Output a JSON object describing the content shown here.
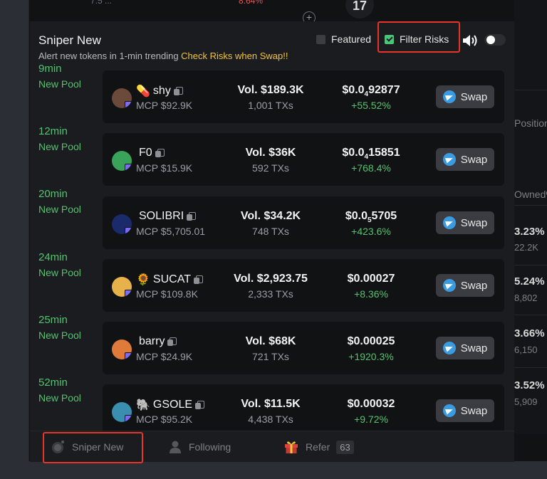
{
  "background": {
    "top_left": "7.5 ...",
    "top_mid": "8.64%",
    "plus": "+",
    "logo": "17",
    "right_col": {
      "header1": "Position",
      "header2": "Owned%",
      "values": [
        {
          "pct": "3.23%",
          "sub": "22.2K"
        },
        {
          "pct": "5.24%",
          "sub": "8,802"
        },
        {
          "pct": "3.66%",
          "sub": "6,150"
        },
        {
          "pct": "3.52%",
          "sub": "5,909"
        }
      ]
    }
  },
  "panel": {
    "title": "Sniper New",
    "subtitle": "Alert new tokens in 1-min trending",
    "subtitle_warning": "Check Risks when Swap!!",
    "featured_label": "Featured",
    "featured_checked": false,
    "filter_risks_label": "Filter Risks",
    "filter_risks_checked": true,
    "sound_icon": "speaker-icon",
    "sound_toggle_on": false
  },
  "rows": [
    {
      "age": "9min",
      "pool": "New Pool",
      "name": "shy",
      "emoji": "💊",
      "mcp": "MCP $92.9K",
      "vol": "Vol. $189.3K",
      "txs": "1,001 TXs",
      "price_a": "$0.0",
      "price_sub": "4",
      "price_b": "92877",
      "pct": "+55.52%",
      "swap": "Swap",
      "avatar_color": "#6b4a3a"
    },
    {
      "age": "12min",
      "pool": "New Pool",
      "name": "F0",
      "emoji": "",
      "mcp": "MCP $15.9K",
      "vol": "Vol. $36K",
      "txs": "592 TXs",
      "price_a": "$0.0",
      "price_sub": "4",
      "price_b": "15851",
      "pct": "+768.4%",
      "swap": "Swap",
      "avatar_color": "#3aa35a"
    },
    {
      "age": "20min",
      "pool": "New Pool",
      "name": "SOLIBRI",
      "emoji": "",
      "mcp": "MCP $5,705.01",
      "vol": "Vol. $34.2K",
      "txs": "748 TXs",
      "price_a": "$0.0",
      "price_sub": "5",
      "price_b": "5705",
      "pct": "+423.6%",
      "swap": "Swap",
      "avatar_color": "#1a2a6b"
    },
    {
      "age": "24min",
      "pool": "New Pool",
      "name": "SUCAT",
      "emoji": "🌻",
      "mcp": "MCP $109.8K",
      "vol": "Vol. $2,923.75",
      "txs": "2,333 TXs",
      "price_a": "$0.00027",
      "price_sub": "",
      "price_b": "",
      "pct": "+8.36%",
      "swap": "Swap",
      "avatar_color": "#e8b24a"
    },
    {
      "age": "25min",
      "pool": "New Pool",
      "name": "barry",
      "emoji": "",
      "mcp": "MCP $24.9K",
      "vol": "Vol. $68K",
      "txs": "721 TXs",
      "price_a": "$0.00025",
      "price_sub": "",
      "price_b": "",
      "pct": "+1920.3%",
      "swap": "Swap",
      "avatar_color": "#e07a3a"
    },
    {
      "age": "52min",
      "pool": "New Pool",
      "name": "GSOLE",
      "emoji": "🐘",
      "mcp": "MCP $95.2K",
      "vol": "Vol. $11.5K",
      "txs": "4,438 TXs",
      "price_a": "$0.00032",
      "price_sub": "",
      "price_b": "",
      "pct": "+9.72%",
      "swap": "Swap",
      "avatar_color": "#3a8fb0"
    }
  ],
  "nav": {
    "sniper_label": "Sniper New",
    "following_label": "Following",
    "refer_label": "Refer",
    "refer_count": "63"
  },
  "colors": {
    "accent_green": "#56c271",
    "warning_yellow": "#f2c53d",
    "highlight_red": "#e8342a",
    "telegram_blue": "#3b9be0"
  }
}
